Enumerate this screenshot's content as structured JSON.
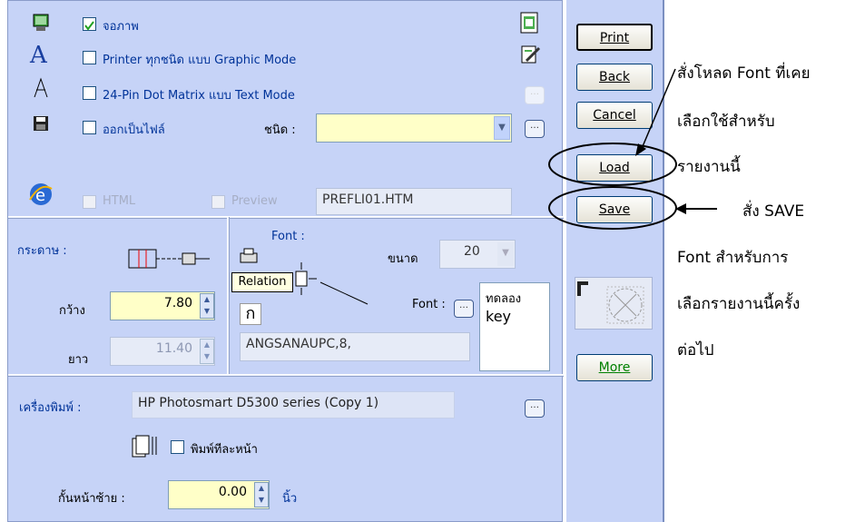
{
  "output": {
    "screen_label": "จอภาพ",
    "printer_label": "Printer ทุกชนิด แบบ Graphic Mode",
    "dotmatrix_label": "24-Pin Dot Matrix แบบ Text Mode",
    "file_label": "ออกเป็นไฟล์",
    "type_label": "ชนิด :",
    "type_value": "",
    "html_label": "HTML",
    "preview_label": "Preview",
    "filename": "PREFLI01.HTM",
    "screen_checked": true,
    "printer_checked": false,
    "dotmatrix_checked": false,
    "file_checked": false
  },
  "paper": {
    "label": "กระดาษ :",
    "width_label": "กว้าง",
    "width_value": "7.80",
    "length_label": "ยาว",
    "length_value": "11.40"
  },
  "font": {
    "title": "Font :",
    "size_label": "ขนาด",
    "size_value": "20",
    "tooltip": "Relation",
    "font_button_label": "Font :",
    "sample_line1": "ทดลอง",
    "sample_line2": "key",
    "font_value": "ANGSANAUPC,8,"
  },
  "printer": {
    "label": "เครื่องพิมพ์ :",
    "value": "HP Photosmart D5300 series (Copy 1)",
    "duplex_label": "พิมพ์ทีละหน้า",
    "margin_label": "กั้นหน้าซ้าย :",
    "margin_value": "0.00",
    "margin_unit": "นิ้ว"
  },
  "buttons": {
    "print": "Print",
    "back": "Back",
    "cancel": "Cancel",
    "load": "Load",
    "save": "Save",
    "more": "More"
  },
  "annotations": {
    "load_line1": "สั่งโหลด Font ที่เคย",
    "load_line2": "เลือกใช้สำหรับ",
    "load_line3": "รายงานนี้",
    "save_line1": "สั่ง SAVE",
    "save_line2": "Font สำหรับการ",
    "save_line3": "เลือกรายงานนี้ครั้ง",
    "save_line4": "ต่อไป"
  }
}
